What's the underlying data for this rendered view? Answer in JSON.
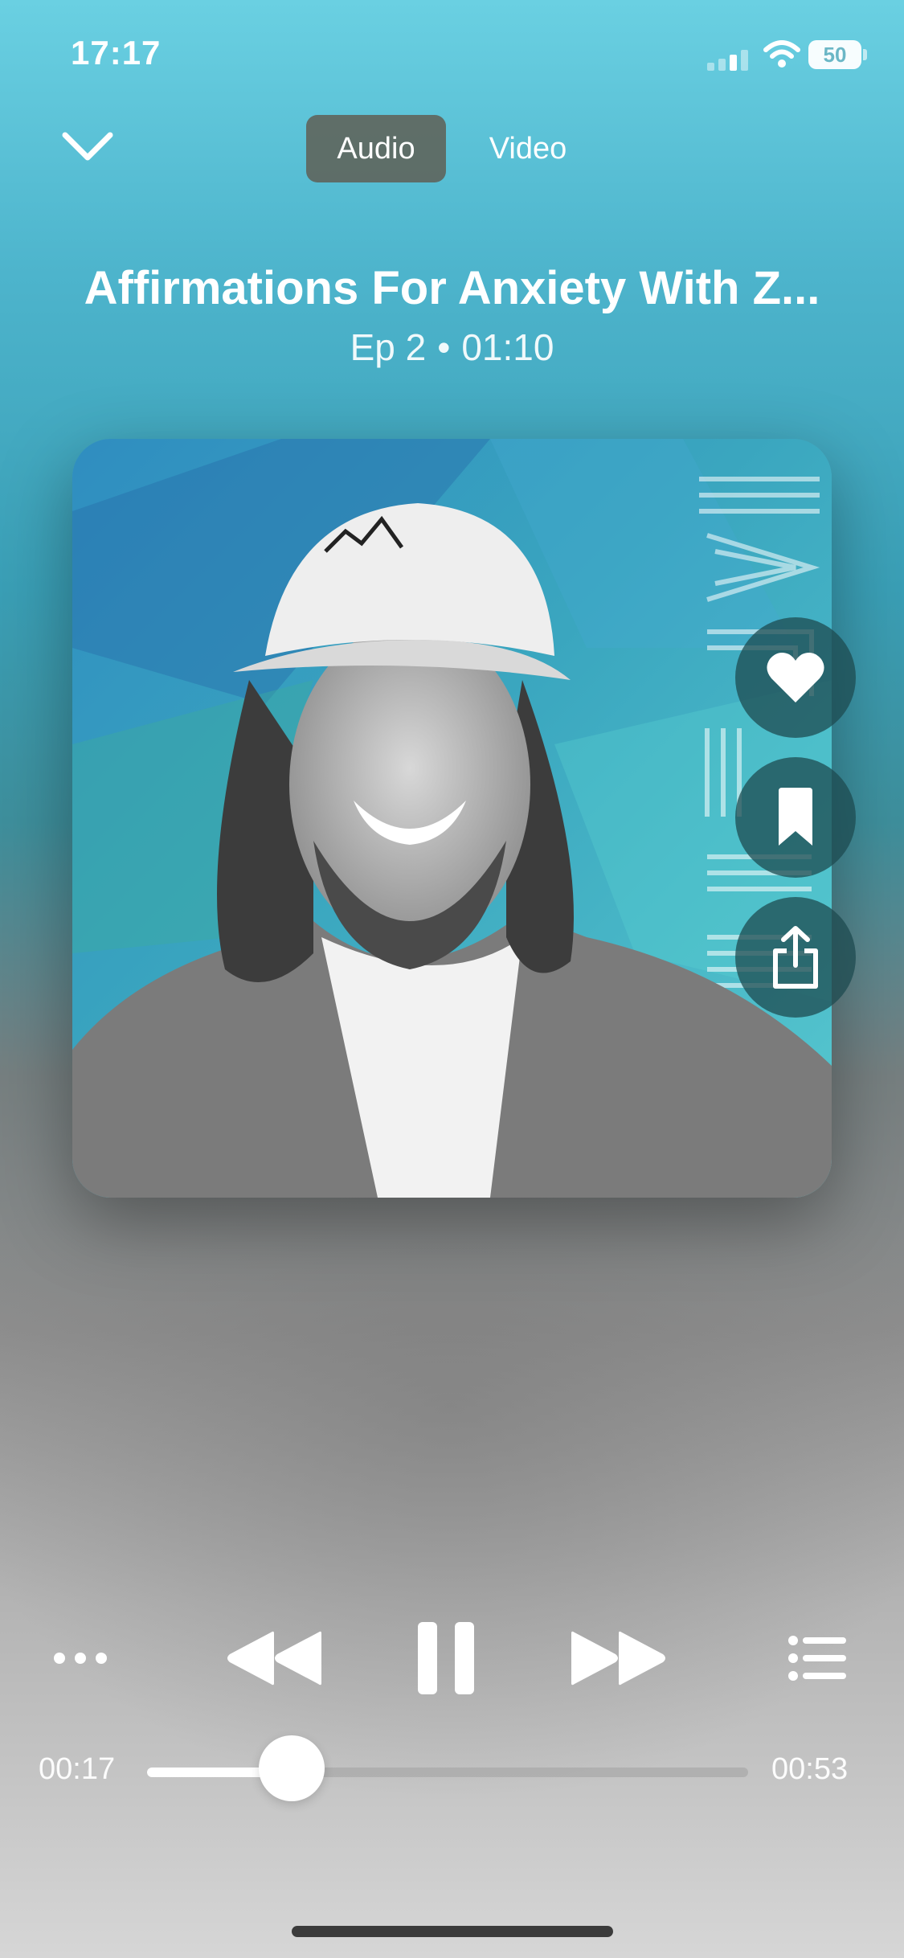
{
  "status_bar": {
    "time": "17:17",
    "battery": "50"
  },
  "nav": {
    "tabs": [
      {
        "label": "Audio",
        "selected": true
      },
      {
        "label": "Video",
        "selected": false
      }
    ]
  },
  "episode": {
    "title": "Affirmations For Anxiety With Z...",
    "episode_label": "Ep 2",
    "duration": "01:10"
  },
  "artwork": {
    "wordmark": "AFFIRM"
  },
  "side_actions": [
    "heart-icon",
    "bookmark-icon",
    "share-icon"
  ],
  "player": {
    "elapsed": "00:17",
    "remaining": "00:53",
    "progress": 0.24,
    "state": "playing"
  }
}
